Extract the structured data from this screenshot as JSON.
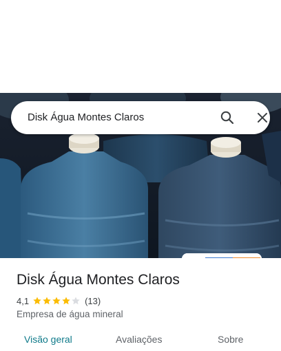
{
  "search": {
    "query": "Disk Água Montes Claros"
  },
  "place": {
    "name": "Disk Água Montes Claros",
    "rating": "4,1",
    "stars_filled": 4,
    "stars_total": 5,
    "review_count": "(13)",
    "category": "Empresa de água mineral"
  },
  "tabs": [
    {
      "label": "Visão geral",
      "active": true
    },
    {
      "label": "Avaliações",
      "active": false
    },
    {
      "label": "Sobre",
      "active": false
    }
  ],
  "colors": {
    "accent": "#0f7a8a",
    "star": "#fbbc04",
    "star_empty": "#dadce0"
  },
  "icons": {
    "search": "search-icon",
    "close": "close-icon",
    "star": "star-icon"
  }
}
